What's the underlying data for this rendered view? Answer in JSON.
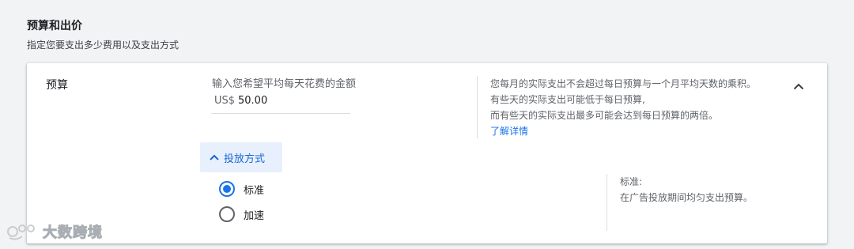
{
  "section": {
    "title": "预算和出价",
    "subtitle": "指定您要支出多少费用以及支出方式"
  },
  "budget": {
    "label": "预算",
    "hint": "输入您希望平均每天花费的金额",
    "currency": "US$",
    "amount": "50.00",
    "info_lines": [
      "您每月的实际支出不会超过每日预算与一个月平均天数的乘积。",
      "有些天的实际支出可能低于每日预算,",
      "而有些天的实际支出最多可能会达到每日预算的两倍。"
    ],
    "learn_more": "了解详情"
  },
  "delivery": {
    "toggle_label": "投放方式",
    "options": [
      {
        "label": "标准",
        "selected": true
      },
      {
        "label": "加速",
        "selected": false
      }
    ],
    "info_title": "标准:",
    "info_text": "在广告投放期间均匀支出预算。"
  },
  "watermark": {
    "text": "大数跨境"
  },
  "colors": {
    "accent": "#1a73e8",
    "toggle_bg": "#e8f0fe",
    "text_secondary": "#5f6368"
  },
  "icons": {
    "collapse": "chevron-up-icon",
    "delivery_toggle": "chevron-up-icon"
  }
}
